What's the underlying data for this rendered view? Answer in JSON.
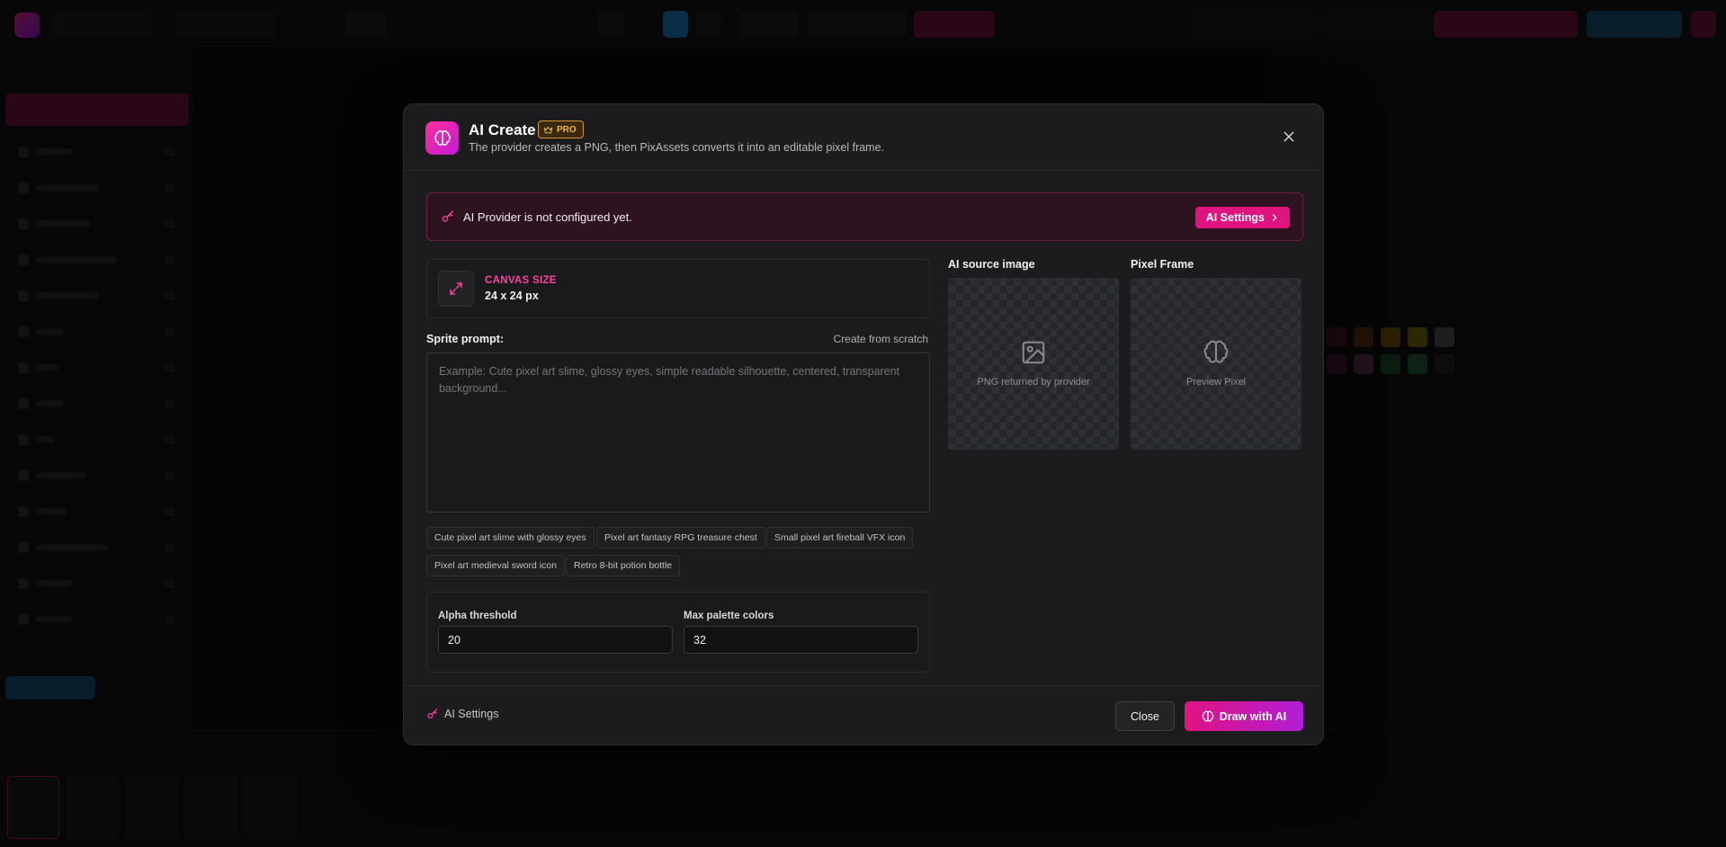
{
  "modal": {
    "title": "AI Create",
    "pro_badge": "PRO",
    "subtitle": "The provider creates a PNG, then PixAssets converts it into an editable pixel frame."
  },
  "alert": {
    "message": "AI Provider is not configured yet.",
    "button_label": "AI Settings"
  },
  "canvas_size": {
    "label": "CANVAS SIZE",
    "value": "24 x 24 px"
  },
  "prompt": {
    "label": "Sprite prompt:",
    "link": "Create from scratch",
    "placeholder": "Example: Cute pixel art slime, glossy eyes, simple readable silhouette, centered, transparent background...",
    "value": ""
  },
  "suggestions": [
    "Cute pixel art slime with glossy eyes",
    "Pixel art fantasy RPG treasure chest",
    "Small pixel art fireball VFX icon",
    "Pixel art medieval sword icon",
    "Retro 8-bit potion bottle"
  ],
  "params": {
    "alpha_label": "Alpha threshold",
    "alpha_value": "20",
    "palette_label": "Max palette colors",
    "palette_value": "32"
  },
  "previews": {
    "source_title": "AI source image",
    "source_placeholder": "PNG returned by provider",
    "frame_title": "Pixel Frame",
    "frame_placeholder": "Preview Pixel"
  },
  "footer": {
    "settings_label": "AI Settings",
    "close_label": "Close",
    "draw_label": "Draw with AI"
  },
  "colors": {
    "accent": "#e0137f",
    "accent_gradient_end": "#b21ed8",
    "pro_gold": "#f0b44a",
    "modal_bg": "#1c1c1e"
  }
}
